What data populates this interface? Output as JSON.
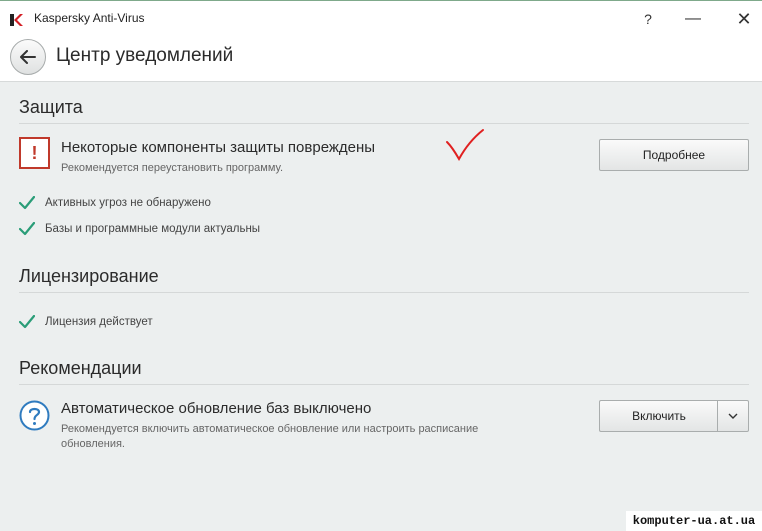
{
  "window": {
    "title": "Kaspersky Anti-Virus",
    "help_label": "?",
    "minimize_label": "—",
    "close_label": "✕"
  },
  "header": {
    "back_icon": "arrow-left-icon",
    "title": "Центр уведомлений"
  },
  "protection": {
    "title": "Защита",
    "alert": {
      "icon": "exclamation-icon",
      "icon_text": "!",
      "title": "Некоторые компоненты защиты повреждены",
      "subtitle": "Рекомендуется переустановить программу.",
      "button_label": "Подробнее"
    },
    "checks": [
      "Активных угроз не обнаружено",
      "Базы и программные модули актуальны"
    ]
  },
  "licensing": {
    "title": "Лицензирование",
    "checks": [
      "Лицензия действует"
    ]
  },
  "recommendations": {
    "title": "Рекомендации",
    "item": {
      "icon": "question-icon",
      "title": "Автоматическое обновление баз выключено",
      "subtitle": "Рекомендуется включить автоматическое обновление или настроить расписание обновления.",
      "button_label": "Включить",
      "dropdown_icon": "chevron-down-icon"
    }
  },
  "watermark": "komputer-ua.at.ua",
  "colors": {
    "accent_green": "#2a9d78",
    "alert_red": "#c0392b",
    "info_blue": "#2f7bbf",
    "background": "#ecefef"
  }
}
